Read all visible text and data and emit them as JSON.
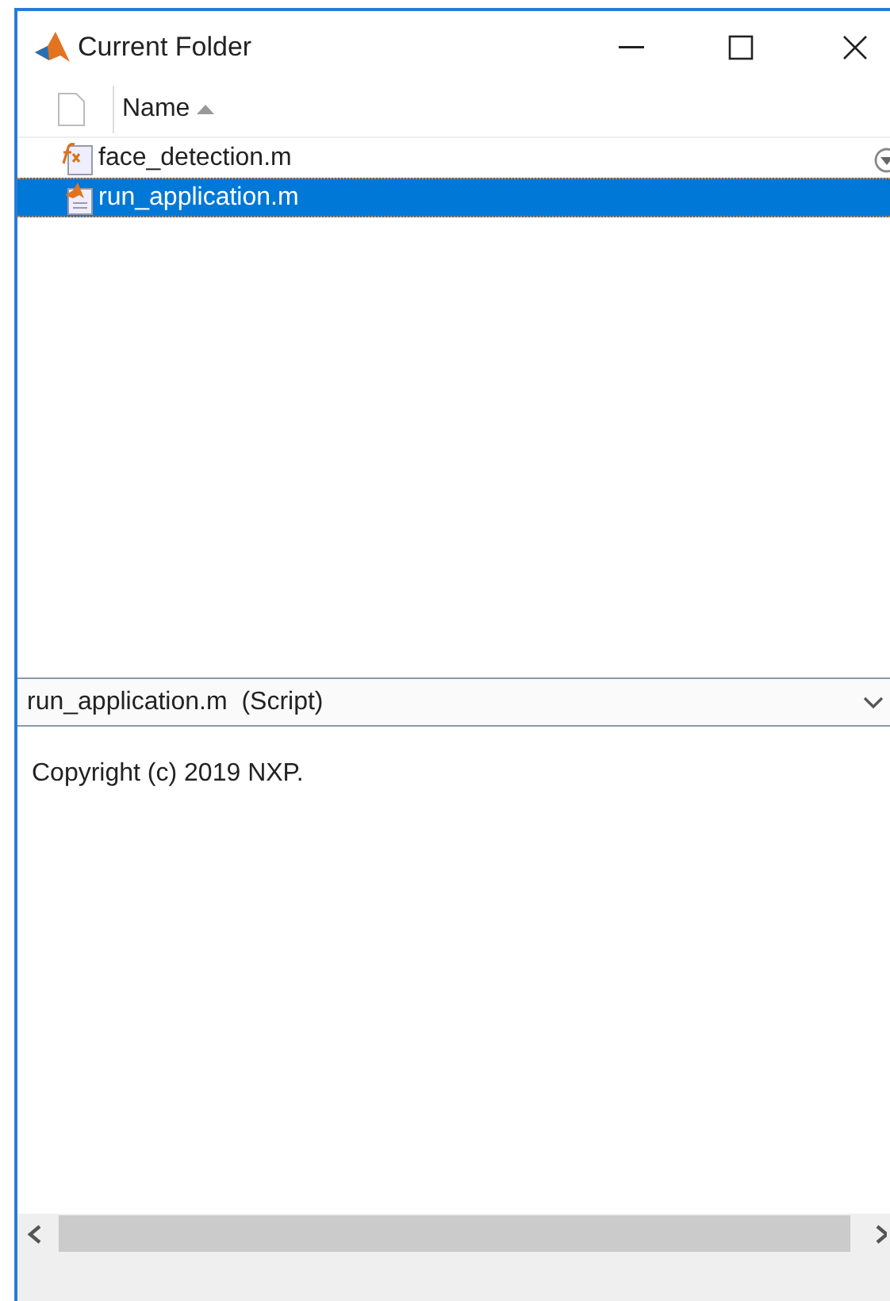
{
  "window": {
    "title": "Current Folder"
  },
  "table": {
    "columns": [
      {
        "label": "Name",
        "sorted": true
      }
    ],
    "rows": [
      {
        "name": "face_detection.m",
        "kind": "function",
        "selected": false
      },
      {
        "name": "run_application.m",
        "kind": "script",
        "selected": true
      }
    ]
  },
  "details": {
    "title": "run_application.m  (Script)",
    "expanded": true,
    "text": "Copyright (c) 2019 NXP."
  }
}
